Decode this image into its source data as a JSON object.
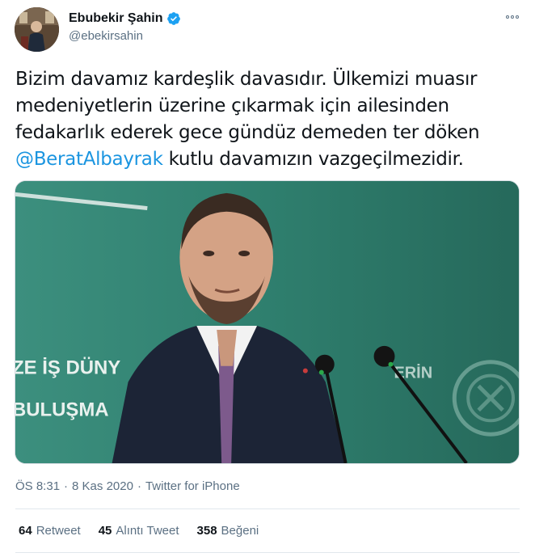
{
  "author": {
    "display_name": "Ebubekir Şahin",
    "handle": "@ebekirsahin",
    "verified": true
  },
  "tweet": {
    "text_before": "Bizim davamız kardeşlik davasıdır. Ülkemizi muasır medeniyetlerin üzerine çıkarmak için ailesinden fedakarlık ederek gece gündüz demeden ter döken ",
    "mention": "@BeratAlbayrak",
    "text_after": " kutlu davamızın vazgeçilmezidir."
  },
  "media": {
    "backdrop_text_line1": "ZE İŞ DÜNY",
    "backdrop_text_line2": "BULUŞMA",
    "backdrop_text_right": "ERİN"
  },
  "meta": {
    "time": "ÖS 8:31",
    "separator": "·",
    "date": "8 Kas 2020",
    "source": "Twitter for iPhone"
  },
  "stats": {
    "retweets_count": "64",
    "retweets_label": "Retweet",
    "quotes_count": "45",
    "quotes_label": "Alıntı Tweet",
    "likes_count": "358",
    "likes_label": "Beğeni"
  },
  "colors": {
    "link": "#1b95e0",
    "verified": "#1da1f2",
    "secondary_text": "#5b7083",
    "backdrop": "#2f7a6a"
  }
}
